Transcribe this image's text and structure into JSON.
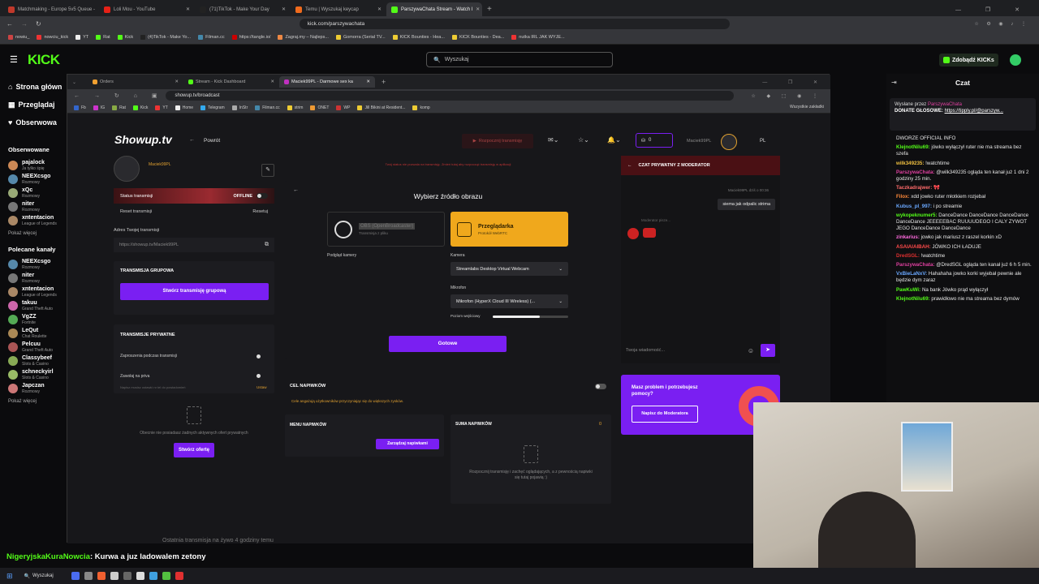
{
  "outer_tabs": [
    {
      "label": "Matchmaking - Europe 5v5 Queue -",
      "color": "#c0392b"
    },
    {
      "label": "Loli Mou - YouTube",
      "color": "#e62117"
    },
    {
      "label": "(71)TikTok - Make Your Day",
      "color": "#222"
    },
    {
      "label": "Temu | Wyszukaj keycap",
      "color": "#f06b1d"
    },
    {
      "label": "ParszywaChata Stream - Watch l",
      "color": "#53fc18"
    }
  ],
  "outer_url": "kick.com/parszywachata",
  "outer_bookmarks": [
    "nowiu_",
    "nowciu_kick",
    "YT",
    "Rat",
    "Kick",
    "(4)TikTok - Make Yo...",
    "Filman.cc",
    "https://tangle.io/",
    "Zagraj.my – Najleps...",
    "Gomorra (Serial TV...",
    "KICK Bounties - Hea...",
    "KICK Bounties - Dea...",
    "nutka IRL JAK WYJE..."
  ],
  "kick": {
    "search_placeholder": "Wyszukaj",
    "kicks_label": "Zdobądź KICKs",
    "nav": [
      "Strona główn",
      "Przeglądaj",
      "Obserwowa"
    ],
    "followed_title": "Obserwowane",
    "followed": [
      {
        "name": "pajalock",
        "sub": "Ja tylko śpię",
        "color": "#c85"
      },
      {
        "name": "NEEXcsgo",
        "sub": "Rozmowy",
        "color": "#58a"
      },
      {
        "name": "xQc",
        "sub": "Rozmowy",
        "color": "#9a7"
      },
      {
        "name": "niter",
        "sub": "Rozmowy",
        "color": "#777"
      },
      {
        "name": "xntentacion",
        "sub": "League of Legends",
        "color": "#a86"
      }
    ],
    "show_more": "Pokaż więcej",
    "recommended_title": "Polecane kanały",
    "recommended": [
      {
        "name": "NEEXcsgo",
        "sub": "Rozmowy",
        "color": "#58a"
      },
      {
        "name": "niter",
        "sub": "Rozmowy",
        "color": "#777"
      },
      {
        "name": "xntentacion",
        "sub": "League of Legends",
        "color": "#a86"
      },
      {
        "name": "takuu",
        "sub": "Grand Theft Auto",
        "color": "#c6a"
      },
      {
        "name": "VgZZ",
        "sub": "Fortnite",
        "color": "#5a5"
      },
      {
        "name": "LeQut",
        "sub": "Chat Roulette",
        "color": "#a85"
      },
      {
        "name": "Pelcuu",
        "sub": "Grand Theft Auto",
        "color": "#a55"
      },
      {
        "name": "Classybeef",
        "sub": "Slots & Casino",
        "color": "#8a5"
      },
      {
        "name": "schneckyirl",
        "sub": "Slots & Casino",
        "color": "#9b6"
      },
      {
        "name": "Japczan",
        "sub": "Rozmowy",
        "color": "#c77"
      }
    ],
    "show_more2": "Pokaż więcej",
    "bottom_msg": {
      "user": "NigeryjskaKuraNowcia",
      "text": ": Kurwa a juz ladowalem zetony"
    },
    "overlay_text": "Ostatnia transmisja na żywo 4 godziny temu"
  },
  "inner": {
    "tabs": [
      "Orders",
      "Stream - Kick Dashboard",
      "Maciek99PL - Darmowe sex ka"
    ],
    "url": "showup.tv/broadcast",
    "bookmarks": [
      "Fb",
      "IG",
      "Rat",
      "Kick",
      "YT",
      "Home",
      "Telegram",
      "InStr",
      "Filman.cc",
      "strim",
      "ONET",
      "WP",
      "Jill Bikini at Resident...",
      "komp"
    ],
    "all_bookmarks": "Wszystkie zakładki"
  },
  "showup": {
    "logo": "Showup.tv",
    "back": "Powrót",
    "start_btn": "Rozpocznij transmisję",
    "coins": "0",
    "username": "Maciek99PL",
    "lang": "PL",
    "status_label": "Status transmisji",
    "offline": "OFFLINE",
    "reset_label": "Reset transmisji",
    "reset_btn": "Resetuj",
    "address_label": "Adres Twojej transmisji",
    "address": "https://showup.tv/Maciek99PL",
    "group_title": "TRANSMISJA GRUPOWA",
    "group_btn": "Stwórz transmisję grupową",
    "private_title": "TRANSMISJE PRYWATNE",
    "priv_invites": "Zaproszenia podczas transmisji",
    "priv_call": "Zawołaj na priva",
    "priv_note": "Napisz musisz ustawić nr tel do powiadomień",
    "priv_set": "Ustaw",
    "offers_empty": "Obecnie nie posiadasz żadnych aktywnych ofert prywatnych",
    "offers_btn": "Stwórz ofertę",
    "warning": "Twój status nie pozwala na transmisję. Zmień tutaj aby rozpocząć transmisję w aplikacji",
    "source_title": "Wybierz źródło obrazu",
    "obs_label": "OBS (OpenBroadcaster)",
    "obs_sub": "Transmisja z pliku",
    "browser_label": "Przeglądarka",
    "browser_sub": "Protokół WebRTC",
    "preview_label": "Podgląd kamery",
    "camera_label": "Kamera",
    "camera_value": "Streamlabs Desktop Virtual Webcam",
    "mic_label": "Mikrofon",
    "mic_value": "Mikrofon (HyperX Cloud III Wireless) (...",
    "level_label": "Poziom wejściowy",
    "level": 0.62,
    "ready_btn": "Gotowe",
    "tips_goal": "CEL NAPIWKÓW",
    "tips_goal_note": "Cele angażują użytkowników przyczyniając się do większych zysków.",
    "tips_menu": "MENU NAPIWKÓW",
    "tips_manage": "Zarządzaj napiwkami",
    "tips_sum": "SUMA NAPIWKÓW",
    "tips_sum_val": "0",
    "tips_empty": "Rozpocznij transmisję i zachęć oglądających, a z pewnością napiwki się tutaj pojawią :)",
    "modchat_title": "CZAT PRYWATNY Z MODERATOR",
    "mod_meta": "Maciek99PL dziś o 00:36",
    "mod_msg": "siema jak odpalic strima",
    "mod_writing": "Moderator pisze...",
    "chat_placeholder": "Twoja wiadomość...",
    "help_title": "Masz problem i potrzebujesz pomocy?",
    "help_btn": "Napisz do Moderatora"
  },
  "chat": {
    "title": "Czat",
    "pinned_user": "Wysłane przez",
    "pinned_name": "ParszywaChata",
    "pinned_text": "DONATE GŁOSOWE:",
    "pinned_link": "https://tipply.pl/@parszyw...",
    "messages": [
      {
        "user": "",
        "color": "#ccc",
        "text": "DWORZE OFFICIAL INFO"
      },
      {
        "user": "KlejnotNilu69:",
        "color": "#53fc18",
        "text": "jówko wyłączył ruter nie ma streama bez szefa"
      },
      {
        "user": "wilk349235:",
        "color": "#f0c040",
        "text": "!watchtime"
      },
      {
        "user": "ParszywaChata:",
        "color": "#e040a0",
        "text": "@wilk349235 ogląda ten kanał już 1 dni 2 godziny 25 min."
      },
      {
        "user": "Taczkadrajwer:",
        "color": "#ff6a6a",
        "text": "🎀"
      },
      {
        "user": "Filox:",
        "color": "#ff8a3a",
        "text": "xdd jowko ruter młotkiem rozjebał"
      },
      {
        "user": "Kubus_pl_997:",
        "color": "#6aa8ff",
        "text": "i po streamie"
      },
      {
        "user": "wykopeknumer5:",
        "color": "#53fc18",
        "text": "DanceDance DanceDance DanceDance DanceDance JEEEEEBAC RUUUUDEGO I CALY ZYWOT JEGO DanceDance DanceDance"
      },
      {
        "user": "zinkarius:",
        "color": "#ff6adf",
        "text": "jowko jak mariusz z raszel korkin xD"
      },
      {
        "user": "ASAIAIAIBAH:",
        "color": "#ff4a4a",
        "text": "JÓWKO ICH ŁADUJE"
      },
      {
        "user": "DredSGL:",
        "color": "#e03030",
        "text": "!watchtime"
      },
      {
        "user": "ParszywaChata:",
        "color": "#e040a0",
        "text": "@DredSGL ogląda ten kanał już 6 h 5 min."
      },
      {
        "user": "VxBieLaNxV:",
        "color": "#6aa8ff",
        "text": "Hahahaha jowko korki wyjebał pewnie ale będzie dym zaraz"
      },
      {
        "user": "PawKuWi:",
        "color": "#53fc18",
        "text": "Na bank Jówko prąd wyłączył"
      },
      {
        "user": "KlejnotNilu69:",
        "color": "#53fc18",
        "text": "prawidłowo nie ma streama bez dymów"
      }
    ]
  },
  "taskbar": {
    "search": "Wyszukaj"
  }
}
